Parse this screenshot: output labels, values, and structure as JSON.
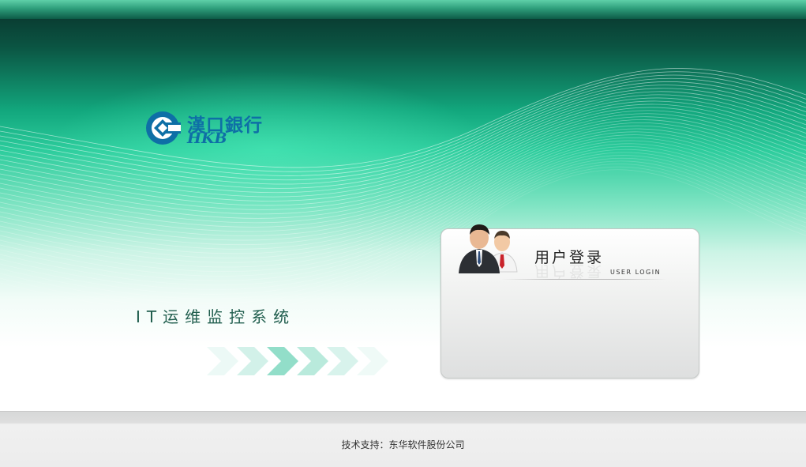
{
  "brand": {
    "name_cn": "漢口銀行",
    "name_en": "HKB"
  },
  "system": {
    "title": "IT运维监控系统"
  },
  "login": {
    "title": "用户登录",
    "subtitle": "USER LOGIN"
  },
  "footer": {
    "text": "技术支持：东华软件股份公司"
  },
  "colors": {
    "banner_dark": "#0a3d32",
    "banner_mid": "#2ccc9c",
    "logo_blue": "#0e6fa6",
    "title_green": "#1f5d4d",
    "arrow_teal": "#7fd8c0"
  },
  "icons": {
    "logo": "hkb-logo-icon",
    "user_group": "user-group-icon",
    "arrows": "chevron-arrows-icon"
  }
}
